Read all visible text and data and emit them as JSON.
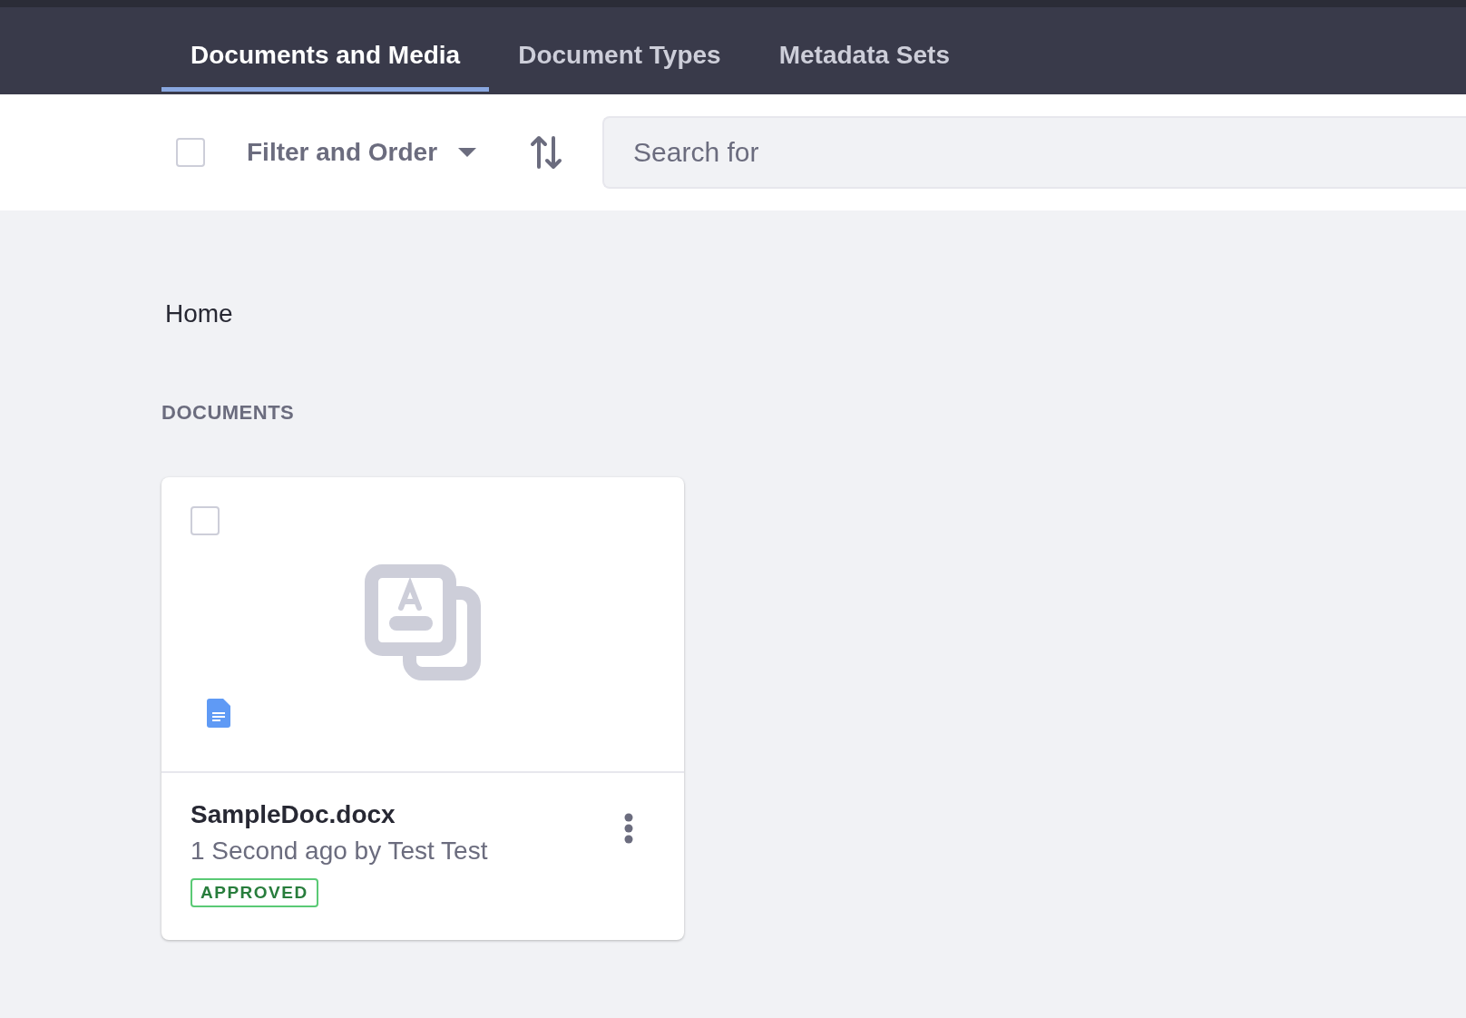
{
  "tabs": [
    {
      "label": "Documents and Media",
      "selected": true
    },
    {
      "label": "Document Types",
      "selected": false
    },
    {
      "label": "Metadata Sets",
      "selected": false
    }
  ],
  "toolbar": {
    "select_all": {
      "checked": false
    },
    "filter": {
      "label": "Filter and Order"
    },
    "search": {
      "placeholder": "Search for"
    }
  },
  "breadcrumb": "Home",
  "section_title": "DOCUMENTS",
  "documents": [
    {
      "title": "SampleDoc.docx",
      "subtitle": "1 Second ago by Test Test",
      "status": "APPROVED",
      "checked": false
    }
  ]
}
